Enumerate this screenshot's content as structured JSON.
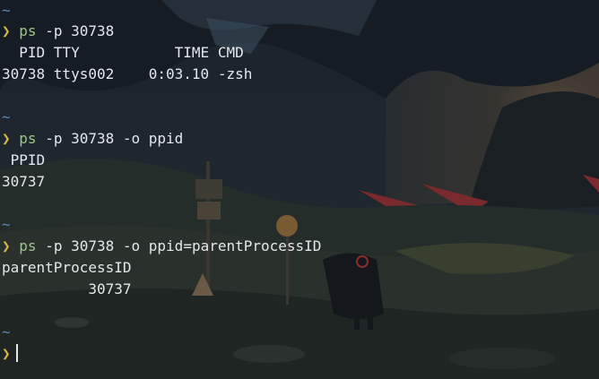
{
  "terminal": {
    "blocks": [
      {
        "cwd": "~",
        "prompt_symbol": "❯",
        "command": "ps",
        "args": "-p 30738",
        "output": [
          "  PID TTY           TIME CMD",
          "30738 ttys002    0:03.10 -zsh"
        ]
      },
      {
        "cwd": "~",
        "prompt_symbol": "❯",
        "command": "ps",
        "args": "-p 30738 -o ppid",
        "output": [
          " PPID",
          "30737"
        ]
      },
      {
        "cwd": "~",
        "prompt_symbol": "❯",
        "command": "ps",
        "args": "-p 30738 -o ppid=parentProcessID",
        "output": [
          "parentProcessID",
          "          30737"
        ]
      }
    ],
    "current_prompt": {
      "cwd": "~",
      "prompt_symbol": "❯",
      "input": ""
    }
  },
  "colors": {
    "prompt_tilde": "#5e87ac",
    "prompt_chevron": "#d7b84e",
    "command": "#9cc78a",
    "text": "#e4e7eb"
  }
}
